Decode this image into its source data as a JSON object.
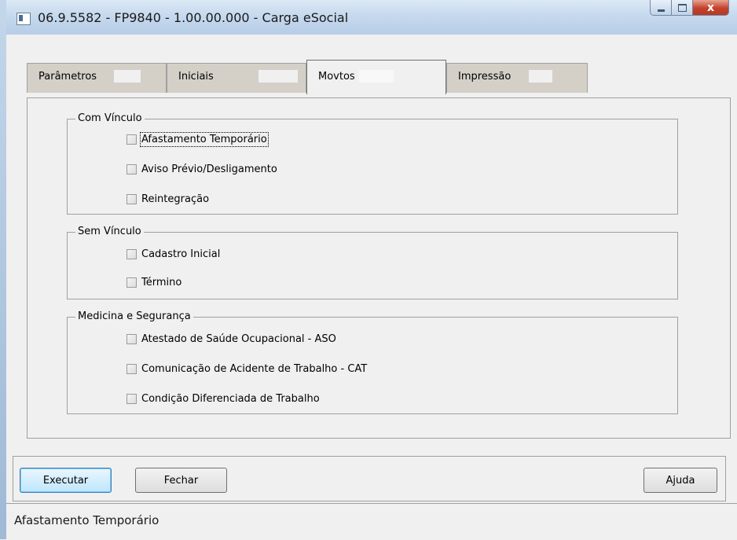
{
  "window": {
    "title": "06.9.5582 - FP9840 - 1.00.00.000 - Carga eSocial",
    "close_glyph": "x"
  },
  "tabs": [
    {
      "label": "Parâmetros",
      "active": false
    },
    {
      "label": "Iniciais",
      "active": false
    },
    {
      "label": "Movtos",
      "active": true
    },
    {
      "label": "Impressão",
      "active": false
    }
  ],
  "groups": {
    "com_vinculo": {
      "legend": "Com Vínculo",
      "items": [
        {
          "label": "Afastamento Temporário",
          "checked": false,
          "focused": true
        },
        {
          "label": "Aviso Prévio/Desligamento",
          "checked": false
        },
        {
          "label": "Reintegração",
          "checked": false
        }
      ]
    },
    "sem_vinculo": {
      "legend": "Sem Vínculo",
      "items": [
        {
          "label": "Cadastro Inicial",
          "checked": false
        },
        {
          "label": "Término",
          "checked": false
        }
      ]
    },
    "medicina": {
      "legend": "Medicina e Segurança",
      "items": [
        {
          "label": "Atestado de Saúde Ocupacional - ASO",
          "checked": false
        },
        {
          "label": "Comunicação de Acidente de Trabalho - CAT",
          "checked": false
        },
        {
          "label": "Condição Diferenciada de Trabalho",
          "checked": false
        }
      ]
    }
  },
  "buttons": {
    "executar": "Executar",
    "fechar": "Fechar",
    "ajuda": "Ajuda"
  },
  "status": {
    "text": "Afastamento Temporário"
  }
}
